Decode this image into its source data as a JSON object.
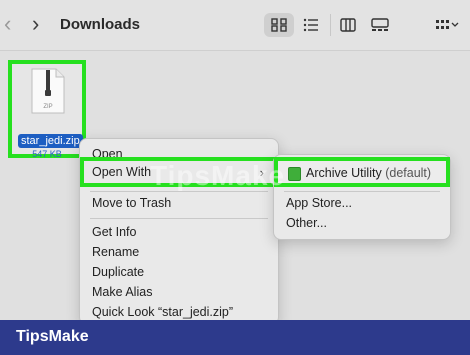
{
  "toolbar": {
    "back_icon": "chevron-left",
    "forward_icon": "chevron-right",
    "title": "Downloads",
    "view_icons": [
      "grid-view-icon",
      "list-view-icon",
      "column-view-icon",
      "gallery-view-icon"
    ],
    "group_icon": "group-by-icon"
  },
  "file": {
    "name": "star_jedi.zip",
    "size": "547 KB",
    "icon_label": "ZIP"
  },
  "context_menu": {
    "items": [
      {
        "label": "Open"
      },
      {
        "label": "Open With",
        "has_submenu": true
      },
      {
        "label": "Move to Trash"
      },
      {
        "label": "Get Info"
      },
      {
        "label": "Rename"
      },
      {
        "label": "Duplicate"
      },
      {
        "label": "Make Alias"
      },
      {
        "label": "Quick Look “star_jedi.zip”"
      }
    ]
  },
  "submenu": {
    "app_name": "Archive Utility",
    "app_default": "(default)",
    "items": [
      {
        "label": "App Store..."
      },
      {
        "label": "Other..."
      }
    ]
  },
  "watermark": "TipsMake",
  "footer": {
    "brand": "TipsMake"
  },
  "colors": {
    "highlight": "#26e01f",
    "footer_bg": "#2d3a8c",
    "selection": "#1d5ec2"
  }
}
